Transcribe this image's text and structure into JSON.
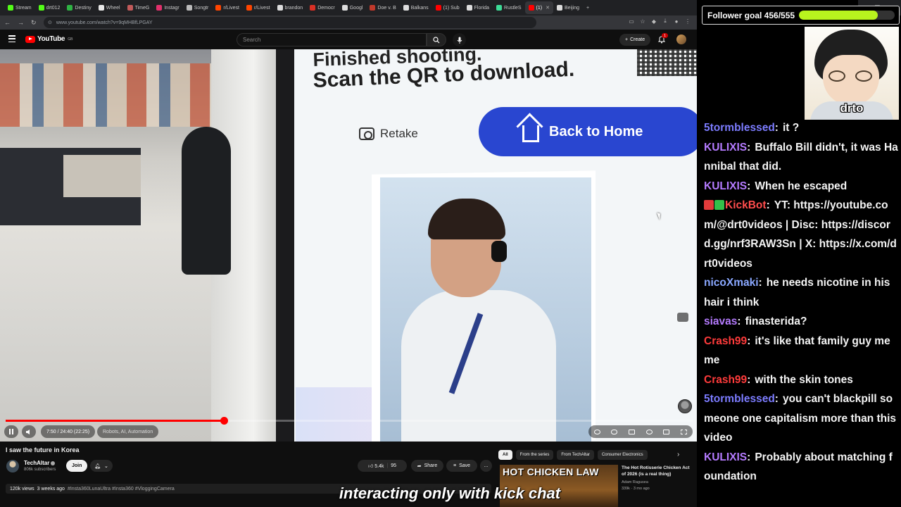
{
  "browser": {
    "tabs": [
      {
        "label": "Stream",
        "color": "#53fc18"
      },
      {
        "label": "drt012",
        "color": "#53fc18"
      },
      {
        "label": "Destiny",
        "color": "#2fb344"
      },
      {
        "label": "Wheel",
        "color": "#e8e8e8"
      },
      {
        "label": "TimeG",
        "color": "#c25a5a"
      },
      {
        "label": "Instagr",
        "color": "#e1306c"
      },
      {
        "label": "Songtr",
        "color": "#bbbbbb"
      },
      {
        "label": "r/Livest",
        "color": "#ff4500"
      },
      {
        "label": "r/Livest",
        "color": "#ff4500"
      },
      {
        "label": "brandon",
        "color": "#dddddd"
      },
      {
        "label": "Democr",
        "color": "#d93025"
      },
      {
        "label": "Googl",
        "color": "#dddddd"
      },
      {
        "label": "Doe v. B",
        "color": "#c0392b"
      },
      {
        "label": "Balkans",
        "color": "#dddddd"
      },
      {
        "label": "(1) Sub",
        "color": "#ff0000"
      },
      {
        "label": "Florida",
        "color": "#dddddd"
      },
      {
        "label": "RustleS",
        "color": "#3ddc97"
      },
      {
        "label": "(1)",
        "color": "#ff0000",
        "active": true
      },
      {
        "label": "Beijing",
        "color": "#dddddd"
      }
    ],
    "url": "www.youtube.com/watch?v=9qMHBfLPGAY"
  },
  "youtube": {
    "logo_text": "YouTube",
    "logo_cc": "GB",
    "search_placeholder": "Search",
    "create_label": "Create",
    "notif_count": "1"
  },
  "player": {
    "time": "7:50 / 24:40 (22:25)",
    "chapter": "Robots, AI, Automation",
    "progress_fraction": 0.3176,
    "screen_line1": "Finished shooting.",
    "screen_line2": "Scan the QR to download.",
    "retake_label": "Retake",
    "home_label": "Back to Home"
  },
  "video": {
    "title": "I saw the future in Korea",
    "channel": "TechAltar",
    "subscribers": "806k subscribers",
    "join_label": "Join",
    "likes": "5.4k",
    "comments": "95",
    "share_label": "Share",
    "save_label": "Save",
    "more_label": "...",
    "views": "120k views",
    "age": "3 weeks ago",
    "tags": "#Insta360LunaUltra #Insta360 #VloggingCamera"
  },
  "sidebar": {
    "chips": [
      {
        "label": "All",
        "active": true
      },
      {
        "label": "From the series"
      },
      {
        "label": "From TechAltar"
      },
      {
        "label": "Consumer Electronics"
      }
    ],
    "rec": {
      "thumb_text": "HOT CHICKEN LAW",
      "title": "The Hot Rotisserie Chicken Act of 2026 (is a real thing)",
      "channel": "Adam Ragusea",
      "meta": "339k · 3 mo ago"
    }
  },
  "caption": "interacting only with kick chat",
  "overlay": {
    "goal_label": "Follower goal 456/555",
    "goal_current": 456,
    "goal_target": 555,
    "goal_color": "#b8f41e",
    "webcam_name": "drto"
  },
  "chat": [
    {
      "user": "5tormblessed",
      "color": "#7c7cff",
      "text": "it ?"
    },
    {
      "user": "KULIXIS",
      "color": "#b57bff",
      "text": "Buffalo Bill didn't, it was Hannibal that did."
    },
    {
      "user": "KULIXIS",
      "color": "#b57bff",
      "text": "When he escaped"
    },
    {
      "user": "KickBot",
      "color": "#ff4d4d",
      "badges": true,
      "text": "YT: https://youtube.com/@drt0videos | Disc: https://discord.gg/nrf3RAW3Sn | X: https://x.com/drt0videos"
    },
    {
      "user": "nicoXmaki",
      "color": "#8aa8ff",
      "text": "he needs nicotine in his hair i think"
    },
    {
      "user": "siavas",
      "color": "#b57bff",
      "text": "finasterida?"
    },
    {
      "user": "Crash99",
      "color": "#ff3b3b",
      "text": "it's like that family guy meme"
    },
    {
      "user": "Crash99",
      "color": "#ff3b3b",
      "text": "with the skin tones"
    },
    {
      "user": "5tormblessed",
      "color": "#7c7cff",
      "text": "you can't blackpill someone one capitalism more than this video"
    },
    {
      "user": "KULIXIS",
      "color": "#b57bff",
      "text": "Probably about matching foundation"
    }
  ]
}
